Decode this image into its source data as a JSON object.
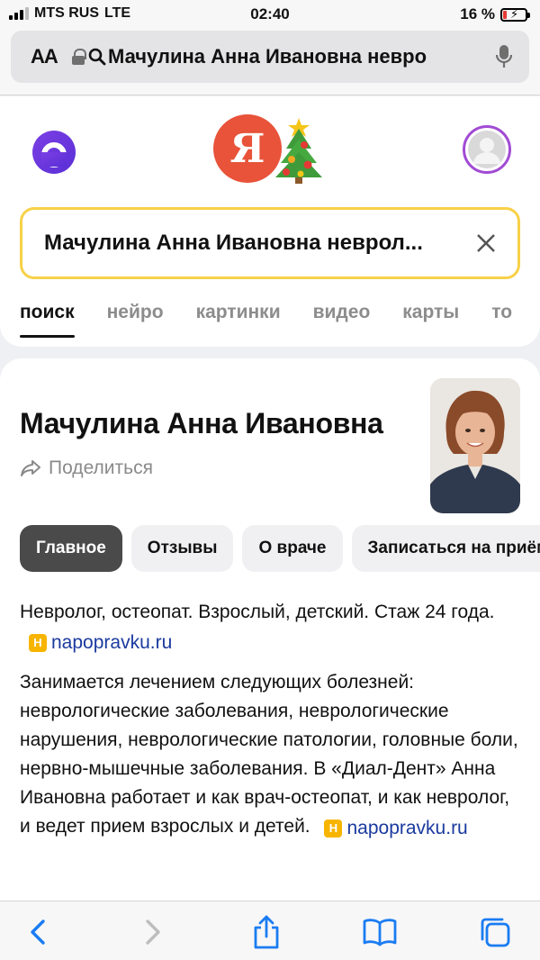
{
  "status_bar": {
    "carrier": "MTS RUS",
    "network": "LTE",
    "time": "02:40",
    "battery_percent": "16 %",
    "battery_level": 0.16
  },
  "address_bar": {
    "text_size_label": "AA",
    "query": "Мачулина Анна Ивановна невро"
  },
  "search": {
    "logo_letter": "Я",
    "query": "Мачулина Анна Ивановна неврол..."
  },
  "tabs": [
    {
      "label": "поиск",
      "active": true
    },
    {
      "label": "нейро",
      "active": false
    },
    {
      "label": "картинки",
      "active": false
    },
    {
      "label": "видео",
      "active": false
    },
    {
      "label": "карты",
      "active": false
    },
    {
      "label": "то",
      "active": false
    }
  ],
  "result": {
    "title": "Мачулина Анна Ивановна",
    "share_label": "Поделиться",
    "chips": [
      {
        "label": "Главное",
        "active": true
      },
      {
        "label": "Отзывы",
        "active": false
      },
      {
        "label": "О враче",
        "active": false
      },
      {
        "label": "Записаться на приём",
        "active": false
      }
    ],
    "paragraph1": "Невролог, остеопат. Взрослый, детский. Стаж 24 года.",
    "paragraph2": "Занимается лечением следующих болезней: неврологические заболевания, неврологические нарушения, неврологические патологии, головные боли, нервно-мышечные заболевания. В «Диал-Дент» Анна Ивановна работает и как врач-остеопат, и как невролог, и ведет прием взрослых и детей.",
    "source": {
      "badge": "H",
      "label": "napopravku.ru"
    }
  },
  "colors": {
    "accent_yellow": "#f7d148",
    "yandex_red": "#e8533a",
    "link_blue": "#1a3a9e",
    "safari_blue": "#1a7cf2"
  }
}
